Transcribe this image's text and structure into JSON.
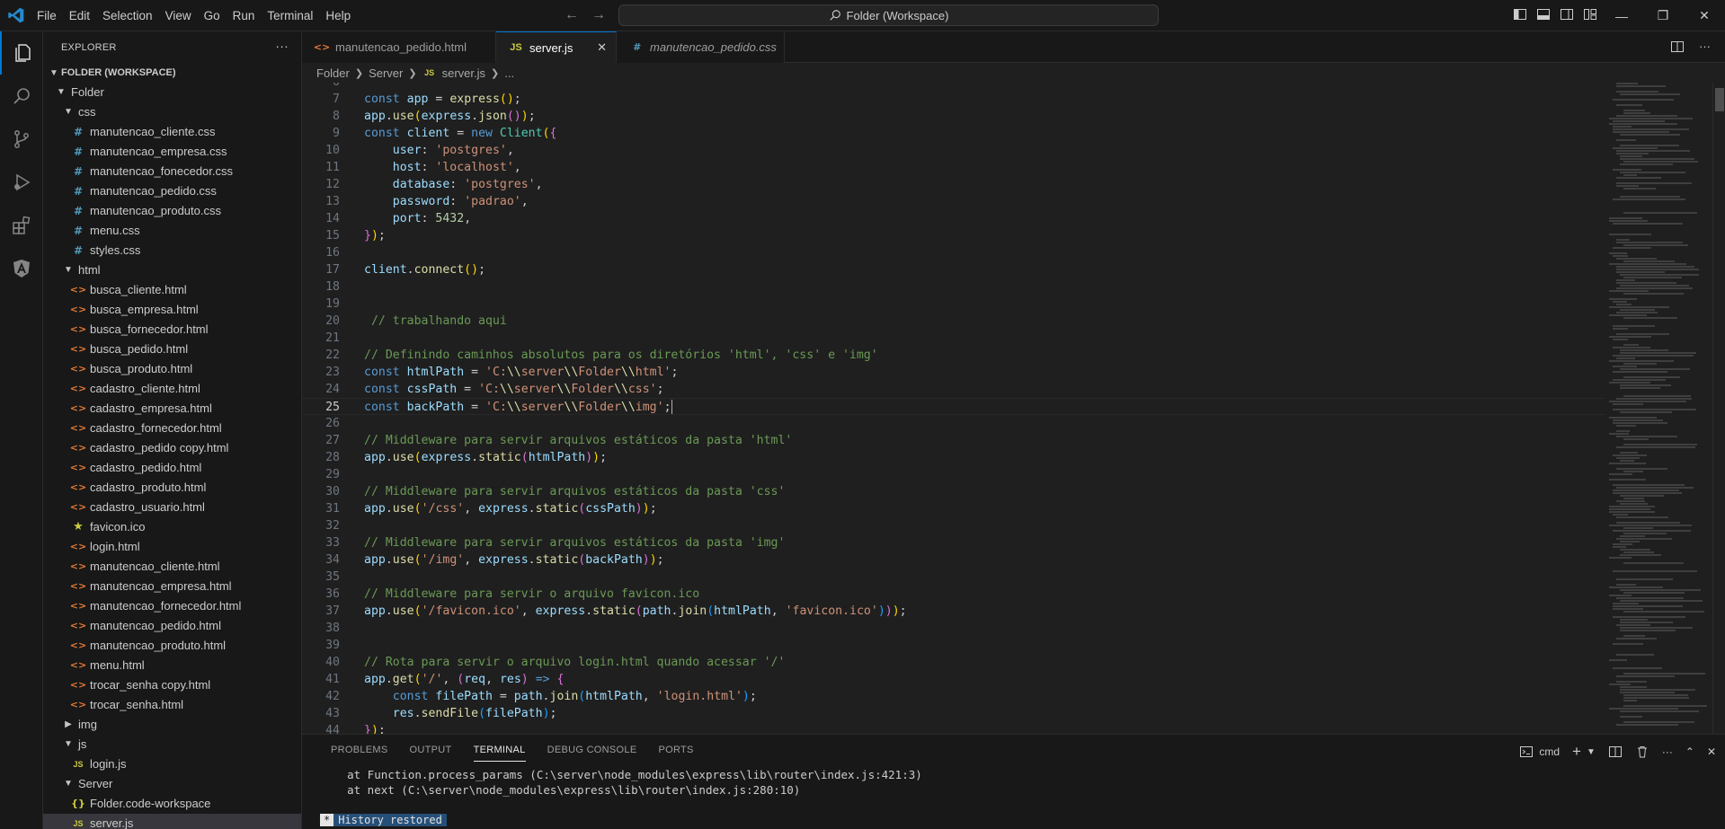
{
  "titlebar": {
    "menu": [
      "File",
      "Edit",
      "Selection",
      "View",
      "Go",
      "Run",
      "Terminal",
      "Help"
    ],
    "command_center": "Folder (Workspace)"
  },
  "sidebar": {
    "title": "EXPLORER",
    "workspace": "FOLDER (WORKSPACE)",
    "tree": [
      {
        "label": "Folder",
        "indent": 1,
        "kind": "folder-open"
      },
      {
        "label": "css",
        "indent": 2,
        "kind": "folder-open"
      },
      {
        "label": "manutencao_cliente.css",
        "indent": 3,
        "kind": "css"
      },
      {
        "label": "manutencao_empresa.css",
        "indent": 3,
        "kind": "css"
      },
      {
        "label": "manutencao_fonecedor.css",
        "indent": 3,
        "kind": "css"
      },
      {
        "label": "manutencao_pedido.css",
        "indent": 3,
        "kind": "css"
      },
      {
        "label": "manutencao_produto.css",
        "indent": 3,
        "kind": "css"
      },
      {
        "label": "menu.css",
        "indent": 3,
        "kind": "css"
      },
      {
        "label": "styles.css",
        "indent": 3,
        "kind": "css"
      },
      {
        "label": "html",
        "indent": 2,
        "kind": "folder-open"
      },
      {
        "label": "busca_cliente.html",
        "indent": 3,
        "kind": "html"
      },
      {
        "label": "busca_empresa.html",
        "indent": 3,
        "kind": "html"
      },
      {
        "label": "busca_fornecedor.html",
        "indent": 3,
        "kind": "html"
      },
      {
        "label": "busca_pedido.html",
        "indent": 3,
        "kind": "html"
      },
      {
        "label": "busca_produto.html",
        "indent": 3,
        "kind": "html"
      },
      {
        "label": "cadastro_cliente.html",
        "indent": 3,
        "kind": "html"
      },
      {
        "label": "cadastro_empresa.html",
        "indent": 3,
        "kind": "html"
      },
      {
        "label": "cadastro_fornecedor.html",
        "indent": 3,
        "kind": "html"
      },
      {
        "label": "cadastro_pedido copy.html",
        "indent": 3,
        "kind": "html"
      },
      {
        "label": "cadastro_pedido.html",
        "indent": 3,
        "kind": "html"
      },
      {
        "label": "cadastro_produto.html",
        "indent": 3,
        "kind": "html"
      },
      {
        "label": "cadastro_usuario.html",
        "indent": 3,
        "kind": "html"
      },
      {
        "label": "favicon.ico",
        "indent": 3,
        "kind": "star"
      },
      {
        "label": "login.html",
        "indent": 3,
        "kind": "html"
      },
      {
        "label": "manutencao_cliente.html",
        "indent": 3,
        "kind": "html"
      },
      {
        "label": "manutencao_empresa.html",
        "indent": 3,
        "kind": "html"
      },
      {
        "label": "manutencao_fornecedor.html",
        "indent": 3,
        "kind": "html"
      },
      {
        "label": "manutencao_pedido.html",
        "indent": 3,
        "kind": "html"
      },
      {
        "label": "manutencao_produto.html",
        "indent": 3,
        "kind": "html"
      },
      {
        "label": "menu.html",
        "indent": 3,
        "kind": "html"
      },
      {
        "label": "trocar_senha copy.html",
        "indent": 3,
        "kind": "html"
      },
      {
        "label": "trocar_senha.html",
        "indent": 3,
        "kind": "html"
      },
      {
        "label": "img",
        "indent": 2,
        "kind": "folder-closed"
      },
      {
        "label": "js",
        "indent": 2,
        "kind": "folder-open"
      },
      {
        "label": "login.js",
        "indent": 3,
        "kind": "js"
      },
      {
        "label": "Server",
        "indent": 2,
        "kind": "folder-open"
      },
      {
        "label": "Folder.code-workspace",
        "indent": 3,
        "kind": "json"
      },
      {
        "label": "server.js",
        "indent": 3,
        "kind": "js",
        "selected": true
      }
    ]
  },
  "tabs": [
    {
      "label": "manutencao_pedido.html",
      "kind": "html",
      "active": false,
      "italic": false
    },
    {
      "label": "server.js",
      "kind": "js",
      "active": true,
      "italic": false
    },
    {
      "label": "manutencao_pedido.css",
      "kind": "css",
      "active": false,
      "italic": true
    }
  ],
  "breadcrumbs": [
    "Folder",
    "Server",
    "server.js",
    "..."
  ],
  "editor": {
    "current_line": 25,
    "lines": [
      {
        "n": 6,
        "html": ""
      },
      {
        "n": 7,
        "html": "<span class='k'>const</span> <span class='v'>app</span> = <span class='f'>express</span><span class='p'>()</span>;"
      },
      {
        "n": 8,
        "html": "<span class='v'>app</span>.<span class='f'>use</span><span class='p'>(</span><span class='v'>express</span>.<span class='f'>json</span><span class='p2'>()</span><span class='p'>)</span>;"
      },
      {
        "n": 9,
        "html": "<span class='k'>const</span> <span class='v'>client</span> = <span class='k'>new</span> <span class='t'>Client</span><span class='p'>(</span><span class='p2'>{</span>"
      },
      {
        "n": 10,
        "html": "    <span class='v'>user</span>: <span class='s'>'postgres'</span>,"
      },
      {
        "n": 11,
        "html": "    <span class='v'>host</span>: <span class='s'>'localhost'</span>,"
      },
      {
        "n": 12,
        "html": "    <span class='v'>database</span>: <span class='s'>'postgres'</span>,"
      },
      {
        "n": 13,
        "html": "    <span class='v'>password</span>: <span class='s'>'padrao'</span>,"
      },
      {
        "n": 14,
        "html": "    <span class='v'>port</span>: <span class='n'>5432</span>,"
      },
      {
        "n": 15,
        "html": "<span class='p2'>}</span><span class='p'>)</span>;"
      },
      {
        "n": 16,
        "html": ""
      },
      {
        "n": 17,
        "html": "<span class='v'>client</span>.<span class='f'>connect</span><span class='p'>()</span>;"
      },
      {
        "n": 18,
        "html": ""
      },
      {
        "n": 19,
        "html": ""
      },
      {
        "n": 20,
        "html": " <span class='c'>// trabalhando aqui</span>"
      },
      {
        "n": 21,
        "html": ""
      },
      {
        "n": 22,
        "html": "<span class='c'>// Definindo caminhos absolutos para os diretórios 'html', 'css' e 'img'</span>"
      },
      {
        "n": 23,
        "html": "<span class='k'>const</span> <span class='v'>htmlPath</span> = <span class='s'>'C:</span><span class='f'>\\\\</span><span class='s'>server</span><span class='f'>\\\\</span><span class='s'>Folder</span><span class='f'>\\\\</span><span class='s'>html'</span>;"
      },
      {
        "n": 24,
        "html": "<span class='k'>const</span> <span class='v'>cssPath</span> = <span class='s'>'C:</span><span class='f'>\\\\</span><span class='s'>server</span><span class='f'>\\\\</span><span class='s'>Folder</span><span class='f'>\\\\</span><span class='s'>css'</span>;"
      },
      {
        "n": 25,
        "html": "<span class='k'>const</span> <span class='v'>backPath</span> = <span class='s'>'C:</span><span class='f'>\\\\</span><span class='s'>server</span><span class='f'>\\\\</span><span class='s'>Folder</span><span class='f'>\\\\</span><span class='s'>img'</span>;<span class='cursor'></span>"
      },
      {
        "n": 26,
        "html": ""
      },
      {
        "n": 27,
        "html": "<span class='c'>// Middleware para servir arquivos estáticos da pasta 'html'</span>"
      },
      {
        "n": 28,
        "html": "<span class='v'>app</span>.<span class='f'>use</span><span class='p'>(</span><span class='v'>express</span>.<span class='f'>static</span><span class='p2'>(</span><span class='v'>htmlPath</span><span class='p2'>)</span><span class='p'>)</span>;"
      },
      {
        "n": 29,
        "html": ""
      },
      {
        "n": 30,
        "html": "<span class='c'>// Middleware para servir arquivos estáticos da pasta 'css'</span>"
      },
      {
        "n": 31,
        "html": "<span class='v'>app</span>.<span class='f'>use</span><span class='p'>(</span><span class='s'>'/css'</span>, <span class='v'>express</span>.<span class='f'>static</span><span class='p2'>(</span><span class='v'>cssPath</span><span class='p2'>)</span><span class='p'>)</span>;"
      },
      {
        "n": 32,
        "html": ""
      },
      {
        "n": 33,
        "html": "<span class='c'>// Middleware para servir arquivos estáticos da pasta 'img'</span>"
      },
      {
        "n": 34,
        "html": "<span class='v'>app</span>.<span class='f'>use</span><span class='p'>(</span><span class='s'>'/img'</span>, <span class='v'>express</span>.<span class='f'>static</span><span class='p2'>(</span><span class='v'>backPath</span><span class='p2'>)</span><span class='p'>)</span>;"
      },
      {
        "n": 35,
        "html": ""
      },
      {
        "n": 36,
        "html": "<span class='c'>// Middleware para servir o arquivo favicon.ico</span>"
      },
      {
        "n": 37,
        "html": "<span class='v'>app</span>.<span class='f'>use</span><span class='p'>(</span><span class='s'>'/favicon.ico'</span>, <span class='v'>express</span>.<span class='f'>static</span><span class='p2'>(</span><span class='v'>path</span>.<span class='f'>join</span><span class='p3'>(</span><span class='v'>htmlPath</span>, <span class='s'>'favicon.ico'</span><span class='p3'>)</span><span class='p2'>)</span><span class='p'>)</span>;"
      },
      {
        "n": 38,
        "html": ""
      },
      {
        "n": 39,
        "html": ""
      },
      {
        "n": 40,
        "html": "<span class='c'>// Rota para servir o arquivo login.html quando acessar '/'</span>"
      },
      {
        "n": 41,
        "html": "<span class='v'>app</span>.<span class='f'>get</span><span class='p'>(</span><span class='s'>'/'</span>, <span class='p2'>(</span><span class='v'>req</span>, <span class='v'>res</span><span class='p2'>)</span> <span class='k'>=&gt;</span> <span class='p2'>{</span>"
      },
      {
        "n": 42,
        "html": "    <span class='k'>const</span> <span class='v'>filePath</span> = <span class='v'>path</span>.<span class='f'>join</span><span class='p3'>(</span><span class='v'>htmlPath</span>, <span class='s'>'login.html'</span><span class='p3'>)</span>;"
      },
      {
        "n": 43,
        "html": "    <span class='v'>res</span>.<span class='f'>sendFile</span><span class='p3'>(</span><span class='v'>filePath</span><span class='p3'>)</span>;"
      },
      {
        "n": 44,
        "html": "<span class='p2'>}</span><span class='p'>)</span>;"
      }
    ]
  },
  "panel": {
    "tabs": [
      "PROBLEMS",
      "OUTPUT",
      "TERMINAL",
      "DEBUG CONSOLE",
      "PORTS"
    ],
    "active_tab": "TERMINAL",
    "shell": "cmd",
    "terminal_lines": [
      "    at Function.process_params (C:\\server\\node_modules\\express\\lib\\router\\index.js:421:3)",
      "    at next (C:\\server\\node_modules\\express\\lib\\router\\index.js:280:10)"
    ],
    "history_mark": "*",
    "history_text": "History restored"
  },
  "colors": {
    "accent": "#0078d4",
    "background": "#1f1f1f",
    "sidebar": "#181818"
  }
}
